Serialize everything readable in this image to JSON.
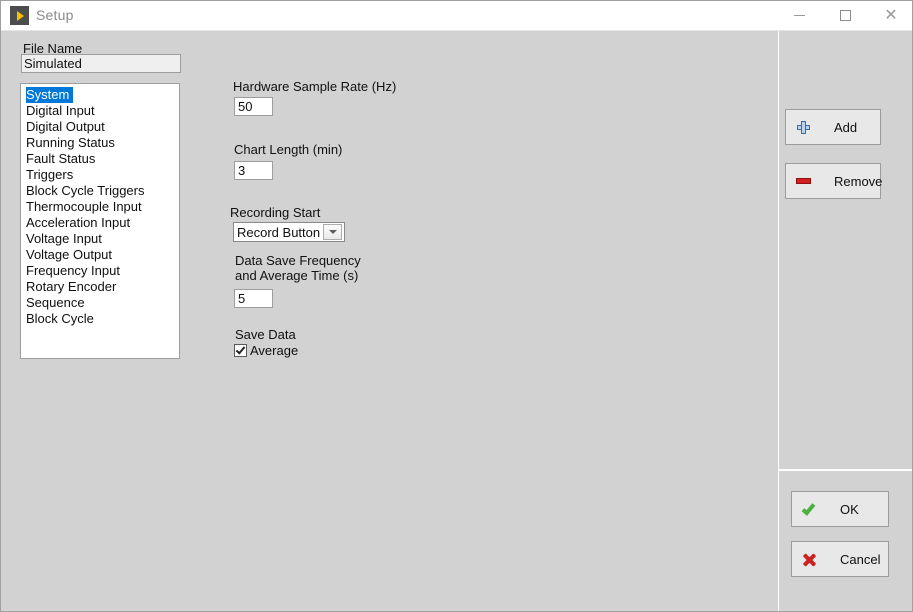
{
  "window": {
    "title": "Setup",
    "app_icon": "labview-run-icon",
    "controls": {
      "minimize": "minimize-icon",
      "maximize": "maximize-icon",
      "close": "close-icon"
    }
  },
  "left_panel": {
    "file_name_label": "File Name",
    "file_name_value": "Simulated",
    "list_items": [
      "System",
      "Digital Input",
      "Digital Output",
      "Running Status",
      "Fault Status",
      "Triggers",
      "Block Cycle Triggers",
      "Thermocouple Input",
      "Acceleration Input",
      "Voltage Input",
      "Voltage Output",
      "Frequency Input",
      "Rotary Encoder",
      "Sequence",
      "Block Cycle"
    ],
    "selected_item": "System",
    "selected_index": 0
  },
  "form": {
    "sample_rate_label": "Hardware Sample Rate (Hz)",
    "sample_rate_value": "50",
    "chart_length_label": "Chart Length (min)",
    "chart_length_value": "3",
    "recording_start_label": "Recording Start",
    "recording_start_value": "Record Button",
    "recording_start_options": [
      "Record Button"
    ],
    "data_save_label_line1": "Data Save Frequency",
    "data_save_label_line2": "and Average Time (s)",
    "data_save_value": "5",
    "save_data_label": "Save Data",
    "average_checkbox_label": "Average",
    "average_checked": true
  },
  "right_panel": {
    "add_label": "Add",
    "add_icon": "plus-icon",
    "remove_label": "Remove",
    "remove_icon": "minus-icon",
    "ok_label": "OK",
    "ok_icon": "check-icon",
    "cancel_label": "Cancel",
    "cancel_icon": "x-icon"
  },
  "colors": {
    "background": "#d2d2d2",
    "selection": "#0078d7",
    "accent_add": "#3a6ea5",
    "accent_remove": "#d42020",
    "accent_ok": "#4caf3f",
    "accent_cancel": "#cc2222",
    "title_icon": "#f5c400"
  }
}
